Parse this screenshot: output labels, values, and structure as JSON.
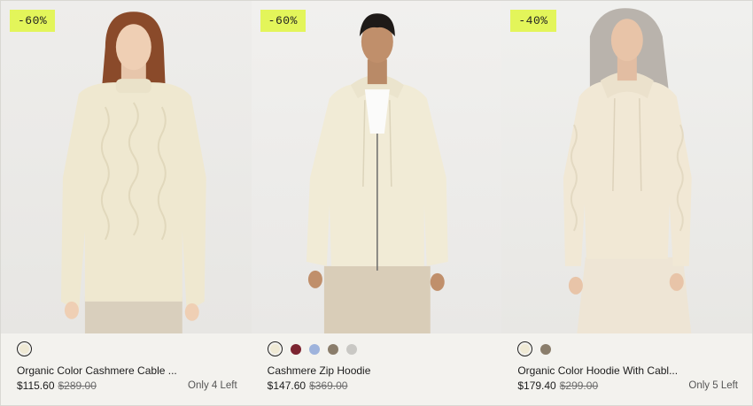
{
  "products": [
    {
      "badge": "-60%",
      "name": "Organic Color Cashmere Cable ...",
      "price": "$115.60",
      "was_price": "$289.00",
      "stock": "Only 4 Left",
      "swatches": [
        "#efe9d4"
      ],
      "selected_swatch": 0,
      "garment_color": "#f1ebd3"
    },
    {
      "badge": "-60%",
      "name": "Cashmere Zip Hoodie",
      "price": "$147.60",
      "was_price": "$369.00",
      "stock": "",
      "swatches": [
        "#efe9d4",
        "#7c2430",
        "#9eb3dc",
        "#8a7d6b",
        "#c9c8c4"
      ],
      "selected_swatch": 0,
      "garment_color": "#f2ecd6"
    },
    {
      "badge": "-40%",
      "name": "Organic Color Hoodie With Cabl...",
      "price": "$179.40",
      "was_price": "$299.00",
      "stock": "Only 5 Left",
      "swatches": [
        "#efe9d4",
        "#8a7d6b"
      ],
      "selected_swatch": 0,
      "garment_color": "#f2e8d6"
    }
  ]
}
